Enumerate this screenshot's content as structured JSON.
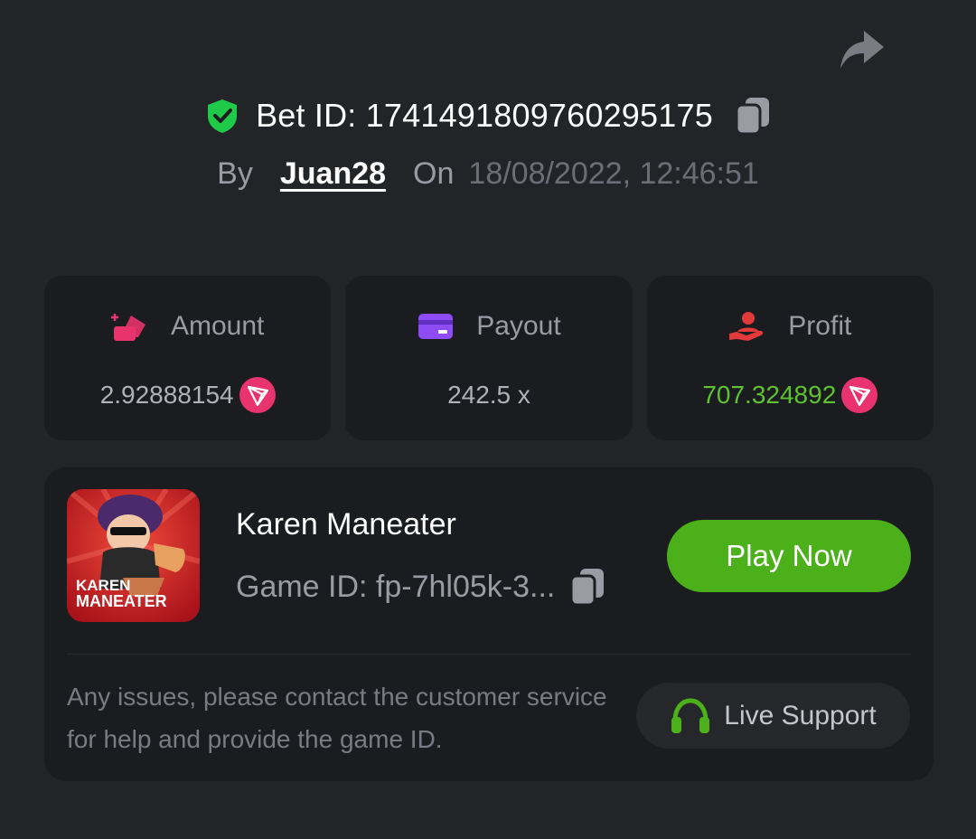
{
  "bet": {
    "id_label": "Bet ID: 1741491809760295175",
    "by_label": "By",
    "username": "Juan28",
    "on_label": "On",
    "datetime": "18/08/2022, 12:46:51"
  },
  "stats": {
    "amount": {
      "label": "Amount",
      "value": "2.92888154",
      "currency_icon": "trx-icon"
    },
    "payout": {
      "label": "Payout",
      "value": "242.5 x"
    },
    "profit": {
      "label": "Profit",
      "value": "707.324892",
      "currency_icon": "trx-icon"
    }
  },
  "game": {
    "name": "Karen Maneater",
    "id_label": "Game ID: fp-7hl05k-3...",
    "thumb_title_line1": "KAREN",
    "thumb_title_line2": "MANEATER",
    "play_label": "Play Now"
  },
  "support": {
    "help_text": "Any issues, please contact the customer service for help and provide the game ID.",
    "button_label": "Live Support"
  },
  "colors": {
    "background": "#232428",
    "card": "#1b1c1f",
    "accent_green": "#4bb01a",
    "profit_green": "#5ec233",
    "amount_pink": "#e8336e",
    "payout_purple": "#8d4cf5",
    "profit_red": "#e23a3a",
    "shield_green": "#1fc94a"
  }
}
